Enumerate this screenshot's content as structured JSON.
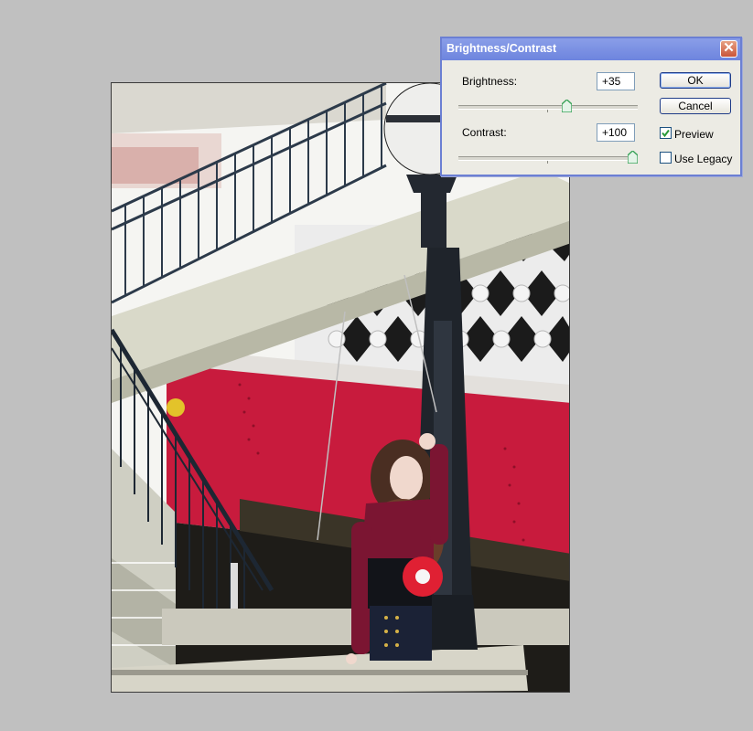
{
  "dialog": {
    "title": "Brightness/Contrast",
    "close_glyph": "✕",
    "brightness": {
      "label": "Brightness:",
      "value": "+35",
      "fraction": 0.61
    },
    "contrast": {
      "label": "Contrast:",
      "value": "+100",
      "fraction": 1.0
    },
    "buttons": {
      "ok": "OK",
      "cancel": "Cancel"
    },
    "checkboxes": {
      "preview": {
        "label": "Preview",
        "checked": true
      },
      "use_legacy": {
        "label": "Use Legacy",
        "checked": false
      }
    },
    "colors": {
      "title_bar": "#7b91e3",
      "body": "#ecebe4",
      "slider_thumb": "#3aa35a"
    }
  },
  "canvas": {
    "image": "photo-woman-on-stairs",
    "background": "#c0c0c0"
  },
  "icons": {
    "close": "close-icon",
    "check": "check-icon",
    "thumb": "slider-thumb-icon"
  }
}
